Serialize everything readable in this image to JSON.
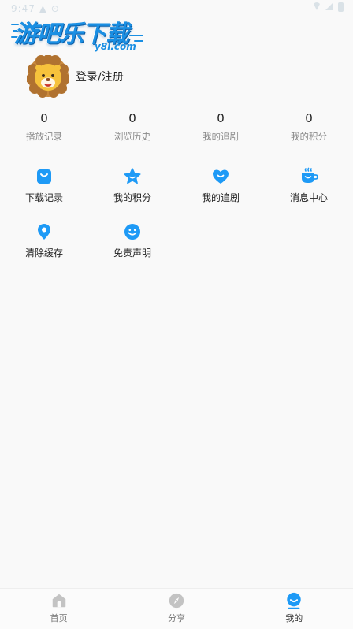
{
  "status_bar": {
    "time": "9:47 ▲ ⊙"
  },
  "watermark": {
    "title": "游吧乐下载",
    "subtitle": "y8l.com"
  },
  "profile": {
    "login_label": "登录/注册",
    "avatar_icon": "lion-avatar-icon"
  },
  "stats": [
    {
      "value": "0",
      "label": "播放记录"
    },
    {
      "value": "0",
      "label": "浏览历史"
    },
    {
      "value": "0",
      "label": "我的追剧"
    },
    {
      "value": "0",
      "label": "我的积分"
    }
  ],
  "menu": [
    {
      "label": "下载记录",
      "icon": "bag-icon"
    },
    {
      "label": "我的积分",
      "icon": "star-icon"
    },
    {
      "label": "我的追剧",
      "icon": "heart-icon"
    },
    {
      "label": "消息中心",
      "icon": "coffee-icon"
    },
    {
      "label": "清除缓存",
      "icon": "location-pin-icon"
    },
    {
      "label": "免责声明",
      "icon": "smile-icon"
    }
  ],
  "tabs": [
    {
      "label": "首页",
      "icon": "home-icon"
    },
    {
      "label": "分享",
      "icon": "compass-icon"
    },
    {
      "label": "我的",
      "icon": "smile-face-icon",
      "active": true
    }
  ],
  "colors": {
    "accent": "#1e9af6",
    "tab_inactive": "#c3c3c3",
    "background": "#f9f9f9"
  }
}
